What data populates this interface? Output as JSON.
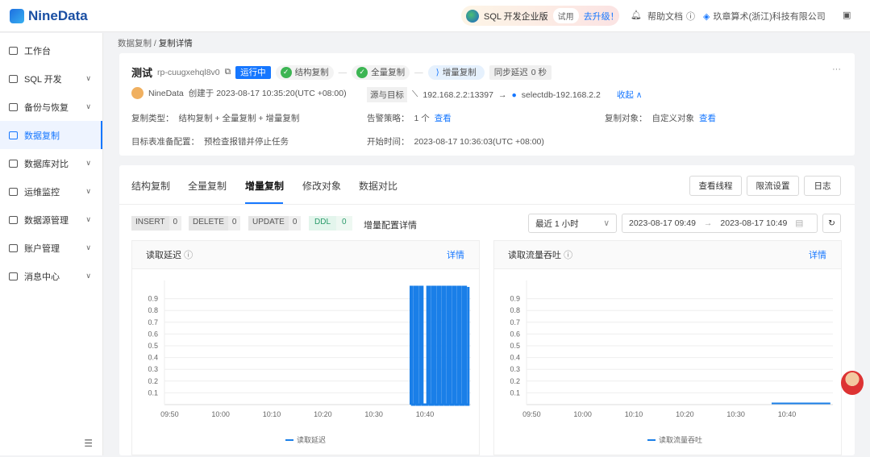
{
  "topbar": {
    "brand": "NineData",
    "promo_label": "SQL 开发企业版",
    "trial": "试用",
    "upgrade": "去升级！",
    "help": "帮助文档",
    "org": "玖章算术(浙江)科技有限公司"
  },
  "sidebar": {
    "items": [
      {
        "label": "工作台"
      },
      {
        "label": "SQL 开发"
      },
      {
        "label": "备份与恢复"
      },
      {
        "label": "数据复制"
      },
      {
        "label": "数据库对比"
      },
      {
        "label": "运维监控"
      },
      {
        "label": "数据源管理"
      },
      {
        "label": "账户管理"
      },
      {
        "label": "消息中心"
      }
    ]
  },
  "breadcrumb": {
    "parent": "数据复制",
    "sep": "/",
    "current": "复制详情"
  },
  "task": {
    "name": "测试",
    "id": "rp-cuugxehql8v0",
    "status": "运行中",
    "steps": [
      "结构复制",
      "全量复制",
      "增量复制"
    ],
    "delay_label": "同步延迟",
    "delay_value": "0 秒",
    "more": "···",
    "creator": "NineData",
    "created": "创建于 2023-08-17 10:35:20(UTC +08:00)",
    "src_tgt_label": "源与目标",
    "source": "192.168.2.2:13397",
    "arrow": "→",
    "target": "selectdb-192.168.2.2",
    "collapse": "收起",
    "type_label": "复制类型：",
    "type_value": "结构复制 + 全量复制 + 增量复制",
    "alert_label": "告警策略：",
    "alert_value": "1 个",
    "alert_link": "查看",
    "object_label": "复制对象：",
    "object_value": "自定义对象",
    "object_link": "查看",
    "prep_label": "目标表准备配置：",
    "prep_value": "预检查报错并停止任务",
    "start_label": "开始时间：",
    "start_value": "2023-08-17 10:36:03(UTC +08:00)"
  },
  "tabs": [
    {
      "label": "结构复制"
    },
    {
      "label": "全量复制"
    },
    {
      "label": "增量复制"
    },
    {
      "label": "修改对象"
    },
    {
      "label": "数据对比"
    }
  ],
  "actions": {
    "threads": "查看线程",
    "throttle": "限流设置",
    "log": "日志"
  },
  "counters": [
    {
      "label": "INSERT",
      "value": "0"
    },
    {
      "label": "DELETE",
      "value": "0"
    },
    {
      "label": "UPDATE",
      "value": "0"
    },
    {
      "label": "DDL",
      "value": "0"
    }
  ],
  "config_detail": "增量配置详情",
  "range": {
    "preset": "最近 1 小时",
    "from": "2023-08-17 09:49",
    "to": "2023-08-17 10:49",
    "arrow": "→"
  },
  "detail_link": "详情",
  "chart_data": [
    {
      "type": "line",
      "title": "读取延迟",
      "legend": "读取延迟",
      "ylim": [
        0,
        1
      ],
      "yticks": [
        "0.1",
        "0.2",
        "0.3",
        "0.4",
        "0.5",
        "0.6",
        "0.7",
        "0.8",
        "0.9"
      ],
      "xticks": [
        "09:50",
        "10:00",
        "10:10",
        "10:20",
        "10:30",
        "10:40"
      ],
      "xrange_min": [
        -1,
        59
      ],
      "series": [
        {
          "name": "读取延迟",
          "x_min_from_0950": [
            47,
            47.5,
            48,
            48.5,
            49,
            49.5,
            50,
            50.5,
            51,
            51.5,
            52,
            52.5,
            53,
            53.5,
            54,
            54.5,
            55,
            55.5,
            56,
            56.5,
            57,
            57.5,
            58,
            58.5
          ],
          "values": [
            1,
            0,
            1,
            0,
            1,
            0,
            0,
            1,
            0,
            1,
            0,
            1,
            0,
            1,
            0,
            1,
            0,
            1,
            0,
            1,
            0,
            1,
            0,
            1
          ]
        }
      ]
    },
    {
      "type": "line",
      "title": "读取流量吞吐",
      "legend": "读取流量吞吐",
      "ylim": [
        0,
        1
      ],
      "yticks": [
        "0.1",
        "0.2",
        "0.3",
        "0.4",
        "0.5",
        "0.6",
        "0.7",
        "0.8",
        "0.9"
      ],
      "xticks": [
        "09:50",
        "10:00",
        "10:10",
        "10:20",
        "10:30",
        "10:40"
      ],
      "xrange_min": [
        -1,
        59
      ],
      "series": [
        {
          "name": "读取流量吞吐",
          "x_min_from_0950": [
            47,
            58.5
          ],
          "values": [
            0.01,
            0.01
          ]
        }
      ]
    }
  ],
  "colors": {
    "accent": "#1677ff",
    "series": "#1a7fe8"
  }
}
